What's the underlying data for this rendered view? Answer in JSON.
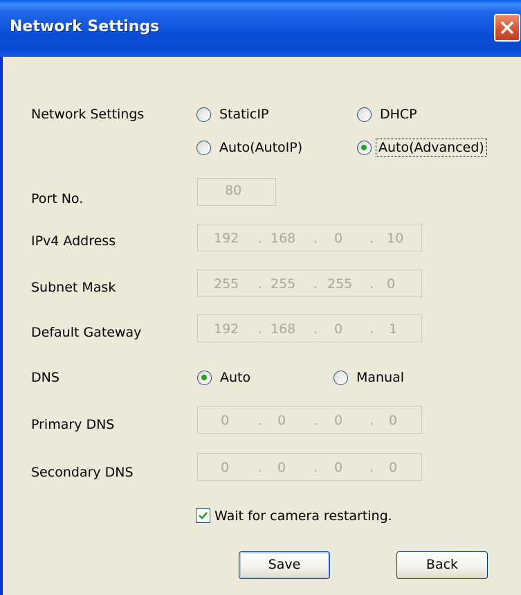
{
  "window": {
    "title": "Network Settings"
  },
  "network_settings": {
    "label": "Network Settings",
    "options": [
      {
        "label": "StaticIP",
        "selected": false
      },
      {
        "label": "DHCP",
        "selected": false
      },
      {
        "label": "Auto(AutoIP)",
        "selected": false
      },
      {
        "label": "Auto(Advanced)",
        "selected": true
      }
    ]
  },
  "port": {
    "label": "Port No.",
    "value": "80"
  },
  "ipv4": {
    "label": "IPv4 Address",
    "octets": [
      "192",
      "168",
      "0",
      "10"
    ]
  },
  "subnet": {
    "label": "Subnet Mask",
    "octets": [
      "255",
      "255",
      "255",
      "0"
    ]
  },
  "gateway": {
    "label": "Default Gateway",
    "octets": [
      "192",
      "168",
      "0",
      "1"
    ]
  },
  "dns": {
    "label": "DNS",
    "options": [
      {
        "label": "Auto",
        "selected": true
      },
      {
        "label": "Manual",
        "selected": false
      }
    ]
  },
  "primary_dns": {
    "label": "Primary DNS",
    "octets": [
      "0",
      "0",
      "0",
      "0"
    ]
  },
  "secondary_dns": {
    "label": "Secondary DNS",
    "octets": [
      "0",
      "0",
      "0",
      "0"
    ]
  },
  "ip_separator": ".",
  "wait_restart": {
    "label": "Wait for camera restarting.",
    "checked": true
  },
  "buttons": {
    "save": "Save",
    "back": "Back"
  },
  "colors": {
    "titlebar": "#0a4fd6",
    "dialog_bg": "#ece9d8",
    "radio_dot": "#21a121",
    "close_button": "#d6522c"
  }
}
